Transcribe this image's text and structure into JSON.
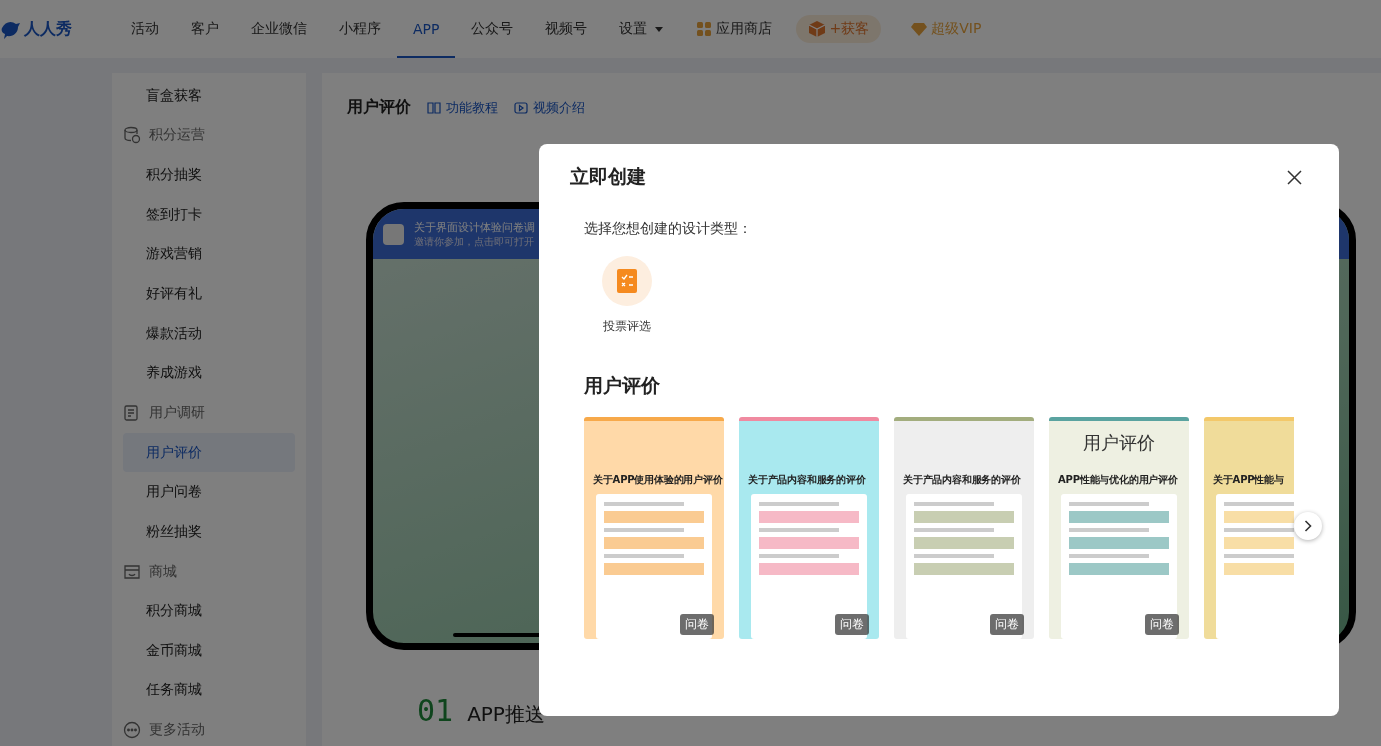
{
  "nav": {
    "logo": "人人秀",
    "items": [
      {
        "label": "活动",
        "selected": false,
        "dropdown": false
      },
      {
        "label": "客户",
        "selected": false,
        "dropdown": false
      },
      {
        "label": "企业微信",
        "selected": false,
        "dropdown": false
      },
      {
        "label": "小程序",
        "selected": false,
        "dropdown": false
      },
      {
        "label": "APP",
        "selected": true,
        "dropdown": false
      },
      {
        "label": "公众号",
        "selected": false,
        "dropdown": false
      },
      {
        "label": "视频号",
        "selected": false,
        "dropdown": false
      },
      {
        "label": "设置",
        "selected": false,
        "dropdown": true
      }
    ],
    "store": "应用商店",
    "acquire": "+获客",
    "vip": "超级VIP"
  },
  "sidebar": {
    "items": [
      {
        "kind": "item",
        "label": "盲盒获客",
        "selected": false
      },
      {
        "kind": "group",
        "label": "积分运营"
      },
      {
        "kind": "item",
        "label": "积分抽奖",
        "selected": false
      },
      {
        "kind": "item",
        "label": "签到打卡",
        "selected": false
      },
      {
        "kind": "item",
        "label": "游戏营销",
        "selected": false
      },
      {
        "kind": "item",
        "label": "好评有礼",
        "selected": false
      },
      {
        "kind": "item",
        "label": "爆款活动",
        "selected": false
      },
      {
        "kind": "item",
        "label": "养成游戏",
        "selected": false
      },
      {
        "kind": "group",
        "label": "用户调研"
      },
      {
        "kind": "item",
        "label": "用户评价",
        "selected": true
      },
      {
        "kind": "item",
        "label": "用户问卷",
        "selected": false
      },
      {
        "kind": "item",
        "label": "粉丝抽奖",
        "selected": false
      },
      {
        "kind": "group",
        "label": "商城"
      },
      {
        "kind": "item",
        "label": "积分商城",
        "selected": false
      },
      {
        "kind": "item",
        "label": "金币商城",
        "selected": false
      },
      {
        "kind": "item",
        "label": "任务商城",
        "selected": false
      },
      {
        "kind": "group",
        "label": "更多活动"
      }
    ]
  },
  "page": {
    "title": "用户评价",
    "links": [
      "功能教程",
      "视频介绍"
    ],
    "phone": {
      "notice_title": "关于界面设计体验问卷调",
      "notice_subtitle": "邀请你参加，点击即可打开"
    },
    "steps": [
      {
        "number": "01",
        "label": "APP推送"
      }
    ]
  },
  "modal": {
    "title": "立即创建",
    "prompt": "选择您想创建的设计类型：",
    "types": [
      {
        "label": "投票评选"
      }
    ],
    "section_title": "用户评价",
    "templates": [
      {
        "title": "关于APP使用体验的用户评价",
        "color": "#f7a94a",
        "badge": "问卷"
      },
      {
        "title": "关于产品内容和服务的评价",
        "color": "#f08aa0",
        "badge": "问卷"
      },
      {
        "title": "关于产品内容和服务的评价",
        "color": "#a3ad7e",
        "badge": "问卷"
      },
      {
        "heading": "用户评价",
        "title": "APP性能与优化的用户评价",
        "color": "#5aa3a0",
        "badge": "问卷"
      },
      {
        "title": "关于APP性能与",
        "color": "#f3c86a"
      }
    ]
  }
}
